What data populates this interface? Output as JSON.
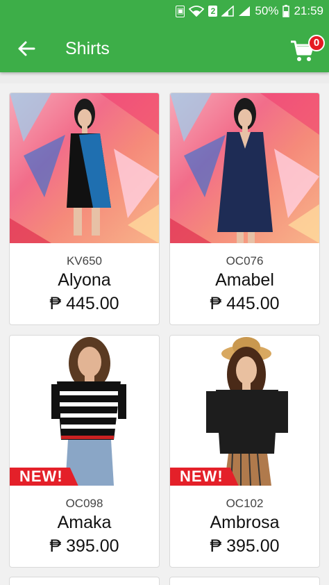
{
  "status_bar": {
    "battery": "50%",
    "time": "21:59",
    "sim_badge": "2"
  },
  "app_bar": {
    "title": "Shirts",
    "cart_count": "0"
  },
  "products": [
    {
      "code": "KV650",
      "name": "Alyona",
      "price": "₱ 445.00",
      "badge": ""
    },
    {
      "code": "OC076",
      "name": "Amabel",
      "price": "₱ 445.00",
      "badge": ""
    },
    {
      "code": "OC098",
      "name": "Amaka",
      "price": "₱ 395.00",
      "badge": "NEW!"
    },
    {
      "code": "OC102",
      "name": "Ambrosa",
      "price": "₱ 395.00",
      "badge": "NEW!"
    }
  ],
  "colors": {
    "app_bar": "#3dae48",
    "badge_red": "#e42029"
  },
  "icons": {
    "back": "arrow-left-icon",
    "cart": "shopping-cart-icon"
  }
}
